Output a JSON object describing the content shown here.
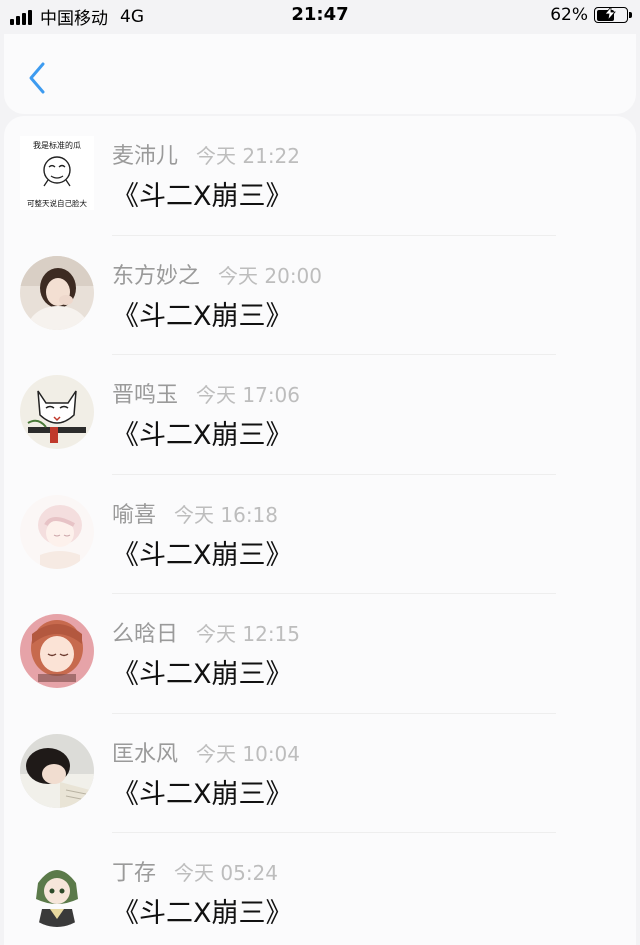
{
  "status_bar": {
    "carrier": "中国移动",
    "network": "4G",
    "time": "21:47",
    "battery_percent": "62%",
    "battery_level": 0.62
  },
  "nav": {
    "back_icon": "chevron-left-icon",
    "accent_color": "#3d9bf0"
  },
  "messages": [
    {
      "name": "麦沛儿",
      "time": "今天 21:22",
      "text": "《斗二X崩三》",
      "avatar_caption_top": "我是标准的瓜",
      "avatar_caption_bottom": "可整天说自己脸大"
    },
    {
      "name": "东方妙之",
      "time": "今天 20:00",
      "text": "《斗二X崩三》"
    },
    {
      "name": "晋鸣玉",
      "time": "今天 17:06",
      "text": "《斗二X崩三》"
    },
    {
      "name": "喻喜",
      "time": "今天 16:18",
      "text": "《斗二X崩三》"
    },
    {
      "name": "么晗日",
      "time": "今天 12:15",
      "text": "《斗二X崩三》"
    },
    {
      "name": "匡水风",
      "time": "今天 10:04",
      "text": "《斗二X崩三》"
    },
    {
      "name": "丁存",
      "time": "今天 05:24",
      "text": "《斗二X崩三》"
    }
  ]
}
